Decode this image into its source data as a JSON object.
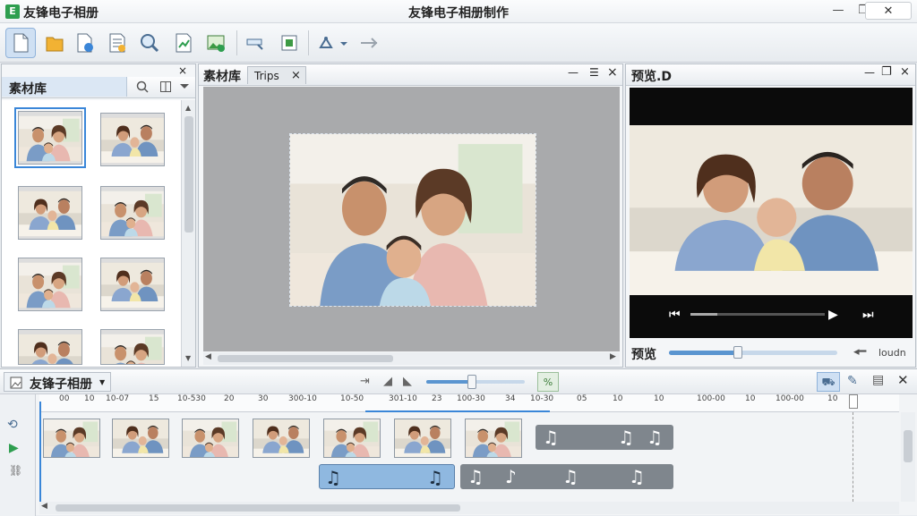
{
  "app": {
    "name": "友锋电子相册",
    "window_title": "友锋电子相册制作"
  },
  "window_controls": {
    "minimize": "—",
    "restore": "❐",
    "close": "✕"
  },
  "toolbar": {
    "buttons": [
      "new",
      "open",
      "save-as",
      "properties",
      "search",
      "export",
      "image",
      "zoom",
      "capture",
      "transform",
      "forward"
    ]
  },
  "material_panel": {
    "title": "素材库",
    "close": "×"
  },
  "editor": {
    "tab_label": "素材库",
    "tab_file": "Trips",
    "tab_close": "×",
    "minimize": "—",
    "menu": "☰",
    "close": "×"
  },
  "preview": {
    "title": "预览.D",
    "label": "预览",
    "volume_label": "loudn",
    "controls": {
      "prev": "⏮",
      "play": "▶",
      "next": "⏭"
    }
  },
  "timeline": {
    "title": "友锋子相册",
    "ruler_ticks": [
      "00",
      "10",
      "10-07",
      "15",
      "10-530",
      "20",
      "30",
      "300-10",
      "10-50",
      "301-10",
      "23",
      "100-30",
      "34",
      "10-30",
      "05",
      "10",
      "10",
      "100-00",
      "10",
      "100-00",
      "10"
    ],
    "audio_labels": [
      "♫",
      "♫",
      "♫",
      "♫",
      "♫",
      "♫",
      "♫",
      "♪",
      "♫",
      "♫"
    ]
  },
  "colors": {
    "accent": "#3a86d8",
    "audio_blue": "#8fb8e0",
    "audio_gray": "#7f868d",
    "canvas_bg": "#a9aaac"
  }
}
